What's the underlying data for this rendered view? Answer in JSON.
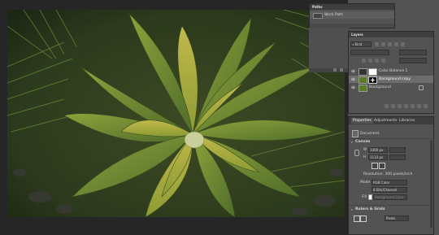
{
  "paths_panel": {
    "title": "Paths",
    "items": [
      {
        "label": "Work Path"
      }
    ]
  },
  "layers_panel": {
    "title": "Layers",
    "filter_kind": "Kind",
    "layers": [
      {
        "name": "Color Balance 1",
        "selected": false
      },
      {
        "name": "Background copy",
        "selected": true
      },
      {
        "name": "Background",
        "selected": false
      }
    ]
  },
  "properties_panel": {
    "tabs": [
      {
        "label": "Properties"
      },
      {
        "label": "Adjustments"
      },
      {
        "label": "Libraries"
      }
    ],
    "document_label": "Document",
    "canvas_section": "Canvas",
    "width": {
      "value": "1400 px"
    },
    "height": {
      "value": "1133 px"
    },
    "resolution": "Resolution: 300 pixels/inch",
    "mode_label": "Mode",
    "mode_value": "RGB Color",
    "depth_value": "8 Bits/Channel",
    "fill_label": "Fill",
    "fill_value": "Background Color",
    "rulers_section": "Rulers & Grids",
    "units_value": "Pixels"
  },
  "colors": {
    "ui_bg": "#535353",
    "panel_header": "#3e3e3e",
    "selected_row": "#6d6d6d",
    "canvas_bg": "#262626"
  }
}
